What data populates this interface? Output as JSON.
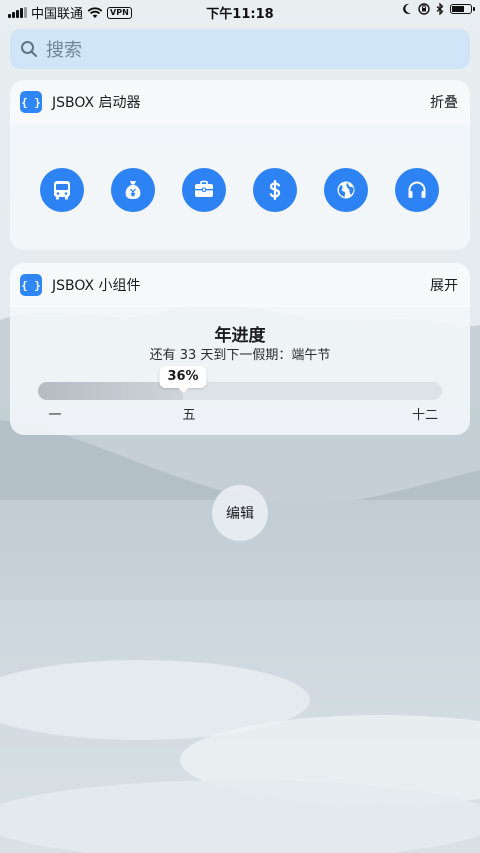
{
  "status_bar": {
    "carrier": "中国联通",
    "vpn": "VPN",
    "time": "下午11:18"
  },
  "search": {
    "placeholder": "搜索"
  },
  "launcher_widget": {
    "icon_label": "{ }",
    "title": "JSBOX 启动器",
    "action": "折叠",
    "buttons": [
      {
        "icon": "bus-icon"
      },
      {
        "icon": "money-bag-icon"
      },
      {
        "icon": "briefcase-icon"
      },
      {
        "icon": "dollar-icon"
      },
      {
        "icon": "globe-icon"
      },
      {
        "icon": "headphones-icon"
      }
    ]
  },
  "progress_widget": {
    "icon_label": "{ }",
    "title": "JSBOX 小组件",
    "action": "展开",
    "heading": "年进度",
    "subtitle": "还有 33 天到下一假期：端午节",
    "percent_label": "36%",
    "progress": 0.36,
    "months": [
      "一",
      "五",
      "十二"
    ]
  },
  "edit_label": "编辑",
  "colors": {
    "accent": "#2d83f3",
    "search_bg": "#cde4f8"
  }
}
